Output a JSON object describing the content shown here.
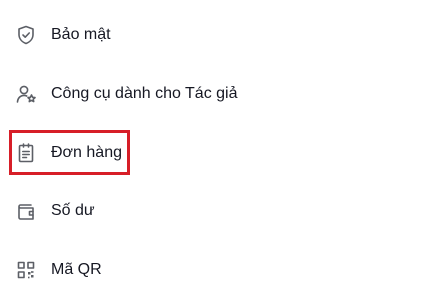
{
  "menu": {
    "items": [
      {
        "label": "Bảo mật",
        "icon": "shield-check-icon"
      },
      {
        "label": "Công cụ dành cho Tác giả",
        "icon": "user-star-icon"
      },
      {
        "label": "Đơn hàng",
        "icon": "order-clipboard-icon"
      },
      {
        "label": "Số dư",
        "icon": "wallet-icon"
      },
      {
        "label": "Mã QR",
        "icon": "qr-code-icon"
      }
    ]
  },
  "highlight": {
    "target": "Đơn hàng",
    "color": "#d71e28"
  },
  "colors": {
    "text": "#161823",
    "icon": "#5c5f66",
    "background": "#ffffff"
  }
}
